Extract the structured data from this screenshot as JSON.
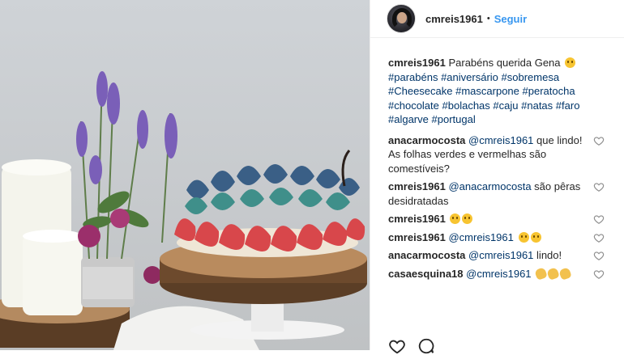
{
  "post": {
    "author": "cmreis1961",
    "follow_label": "Seguir",
    "separator": "•"
  },
  "caption": {
    "user": "cmreis1961",
    "text": "Parabéns querida Gena",
    "hashtags": [
      "#parabéns",
      "#aniversário",
      "#sobremesa",
      "#Cheesecake",
      "#mascarpone",
      "#peratocha",
      "#chocolate",
      "#bolachas",
      "#caju",
      "#natas",
      "#faro",
      "#algarve",
      "#portugal"
    ]
  },
  "comments": [
    {
      "user": "anacarmocosta",
      "mention": "@cmreis1961",
      "text": "que lindo! As folhas verdes e vermelhas são comestíveis?",
      "emoji": ""
    },
    {
      "user": "cmreis1961",
      "mention": "@anacarmocosta",
      "text": "são pêras desidratadas",
      "emoji": ""
    },
    {
      "user": "cmreis1961",
      "mention": "",
      "text": "",
      "emoji": "smile-x2"
    },
    {
      "user": "cmreis1961",
      "mention": "@cmreis1961",
      "text": "",
      "emoji": "smile-x2"
    },
    {
      "user": "anacarmocosta",
      "mention": "@cmreis1961",
      "text": "lindo!",
      "emoji": ""
    },
    {
      "user": "casaesquina18",
      "mention": "@cmreis1961",
      "text": "",
      "emoji": "clap-x3"
    }
  ],
  "colors": {
    "link": "#003569",
    "follow": "#3897f0",
    "text": "#262626"
  },
  "icons": [
    "heart-icon",
    "comment-icon",
    "share-icon",
    "bookmark-icon"
  ]
}
